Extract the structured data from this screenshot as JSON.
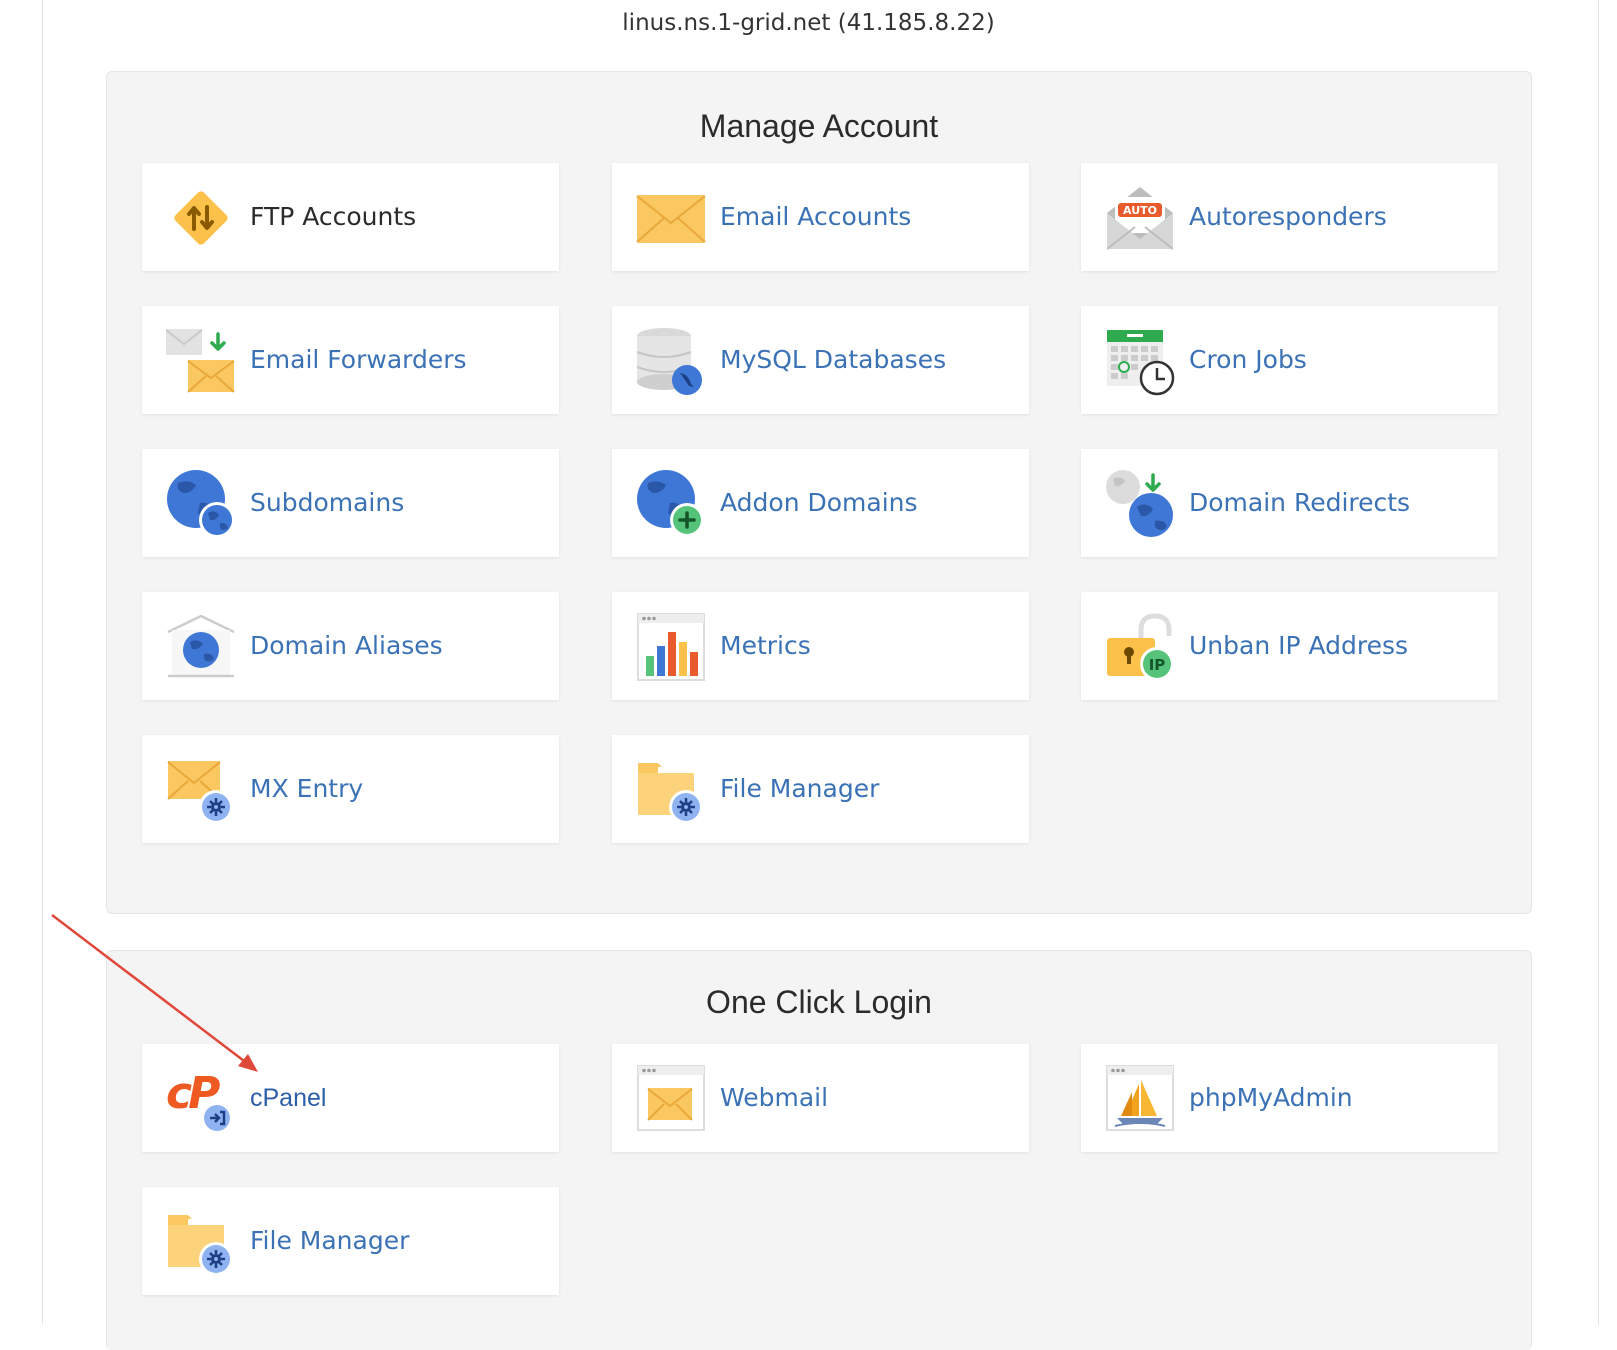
{
  "header": {
    "server_info": "linus.ns.1-grid.net (41.185.8.22)"
  },
  "manage_account": {
    "title": "Manage Account",
    "tiles": [
      {
        "label": "FTP Accounts",
        "icon": "ftp-icon"
      },
      {
        "label": "Email Accounts",
        "icon": "email-icon"
      },
      {
        "label": "Autoresponders",
        "icon": "autoresponder-icon",
        "badge": "AUTO"
      },
      {
        "label": "Email Forwarders",
        "icon": "email-forwarder-icon"
      },
      {
        "label": "MySQL Databases",
        "icon": "database-icon"
      },
      {
        "label": "Cron Jobs",
        "icon": "calendar-clock-icon"
      },
      {
        "label": "Subdomains",
        "icon": "globe-icon"
      },
      {
        "label": "Addon Domains",
        "icon": "globe-plus-icon"
      },
      {
        "label": "Domain Redirects",
        "icon": "globe-redirect-icon"
      },
      {
        "label": "Domain Aliases",
        "icon": "globe-house-icon"
      },
      {
        "label": "Metrics",
        "icon": "bar-chart-icon"
      },
      {
        "label": "Unban IP Address",
        "icon": "padlock-ip-icon",
        "badge": "IP"
      },
      {
        "label": "MX Entry",
        "icon": "mail-gear-icon"
      },
      {
        "label": "File Manager",
        "icon": "folder-gear-icon"
      }
    ]
  },
  "one_click_login": {
    "title": "One Click Login",
    "tiles": [
      {
        "label": "cPanel",
        "icon": "cpanel-logo-icon",
        "logo_text": "cP"
      },
      {
        "label": "Webmail",
        "icon": "webmail-icon"
      },
      {
        "label": "phpMyAdmin",
        "icon": "phpmyadmin-icon"
      },
      {
        "label": "File Manager",
        "icon": "folder-gear-icon"
      }
    ]
  },
  "colors": {
    "link": "#3b72b6",
    "panel_bg": "#f4f4f4",
    "arrow": "#e0483a",
    "icon_yellow": "#fbc760",
    "icon_blue": "#3f77d6"
  }
}
